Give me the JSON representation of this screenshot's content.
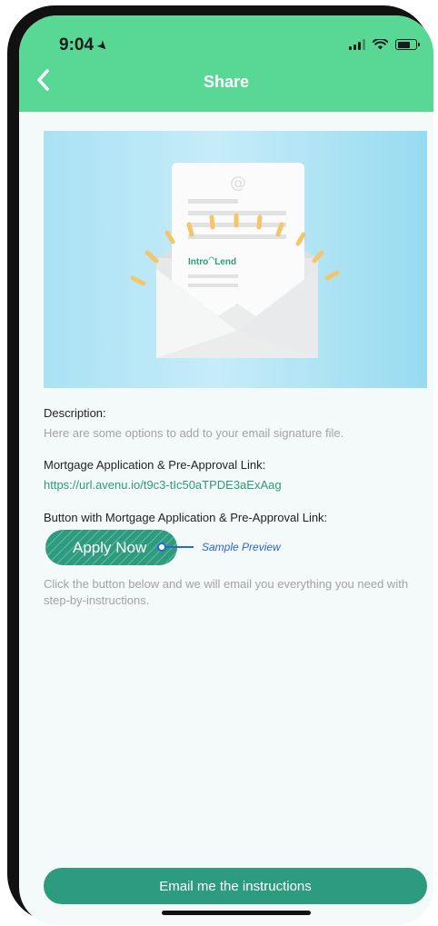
{
  "status_bar": {
    "time": "9:04",
    "location_glyph": "➤"
  },
  "nav": {
    "back_glyph": "‹",
    "title": "Share"
  },
  "hero": {
    "at_symbol": "@",
    "brand_text": "Intro",
    "brand_text_2": "Lend"
  },
  "description": {
    "label": "Description:",
    "text": "Here are some options to add to your email signature file."
  },
  "link_section": {
    "label": "Mortgage Application & Pre-Approval Link:",
    "url": "https://url.avenu.io/t9c3-tIc50aTPDE3aExAag"
  },
  "button_section": {
    "label": "Button with Mortgage Application & Pre-Approval Link:",
    "apply_label": "Apply Now",
    "preview_label": "Sample Preview"
  },
  "help_text": "Click the button below and we will email you everything you need with step-by-instructions.",
  "email_button_label": "Email me the instructions",
  "colors": {
    "header_green": "#59d895",
    "button_green": "#2d9b7e",
    "link_green": "#2a9d78",
    "preview_blue": "#2a66d6"
  }
}
